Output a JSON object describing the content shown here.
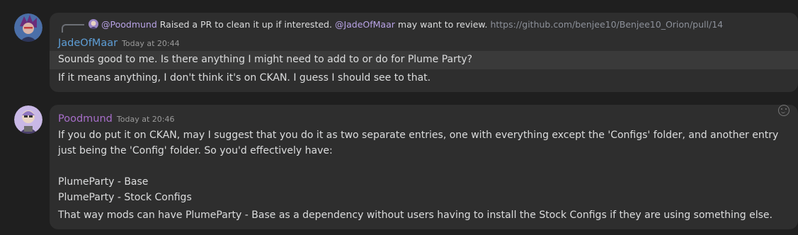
{
  "reply": {
    "mention": "@Poodmund",
    "text": "Raised a PR to clean it up if interested.",
    "mention2": "@JadeOfMaar",
    "text2": "may want to review.",
    "link": "https://github.com/benjee10/Benjee10_Orion/pull/14"
  },
  "messages": [
    {
      "author": "JadeOfMaar",
      "timestamp": "Today at 20:44",
      "lines": [
        "Sounds good to me. Is there anything I might need to add to or do for Plume Party?",
        "If it means anything, I don't think it's on CKAN. I guess I should see to that."
      ]
    },
    {
      "author": "Poodmund",
      "timestamp": "Today at 20:46",
      "lines": [
        "If you do put it on CKAN, may I suggest that you do it as two separate entries, one with everything except the 'Configs' folder, and another entry",
        "just being the 'Config' folder. So you'd effectively have:",
        "PlumeParty - Base",
        "PlumeParty - Stock Configs",
        "That way mods can have PlumeParty - Base as a dependency without users having to install the Stock Configs if they are using something else."
      ]
    }
  ],
  "colors": {
    "background": "#1f1f1f",
    "message_group": "#2e2e2e",
    "author1": "#5e9ed6",
    "author2": "#a76ec9",
    "mention": "#b9a3e6"
  },
  "icons": [
    "reply-spine-icon",
    "smiley-icon"
  ]
}
